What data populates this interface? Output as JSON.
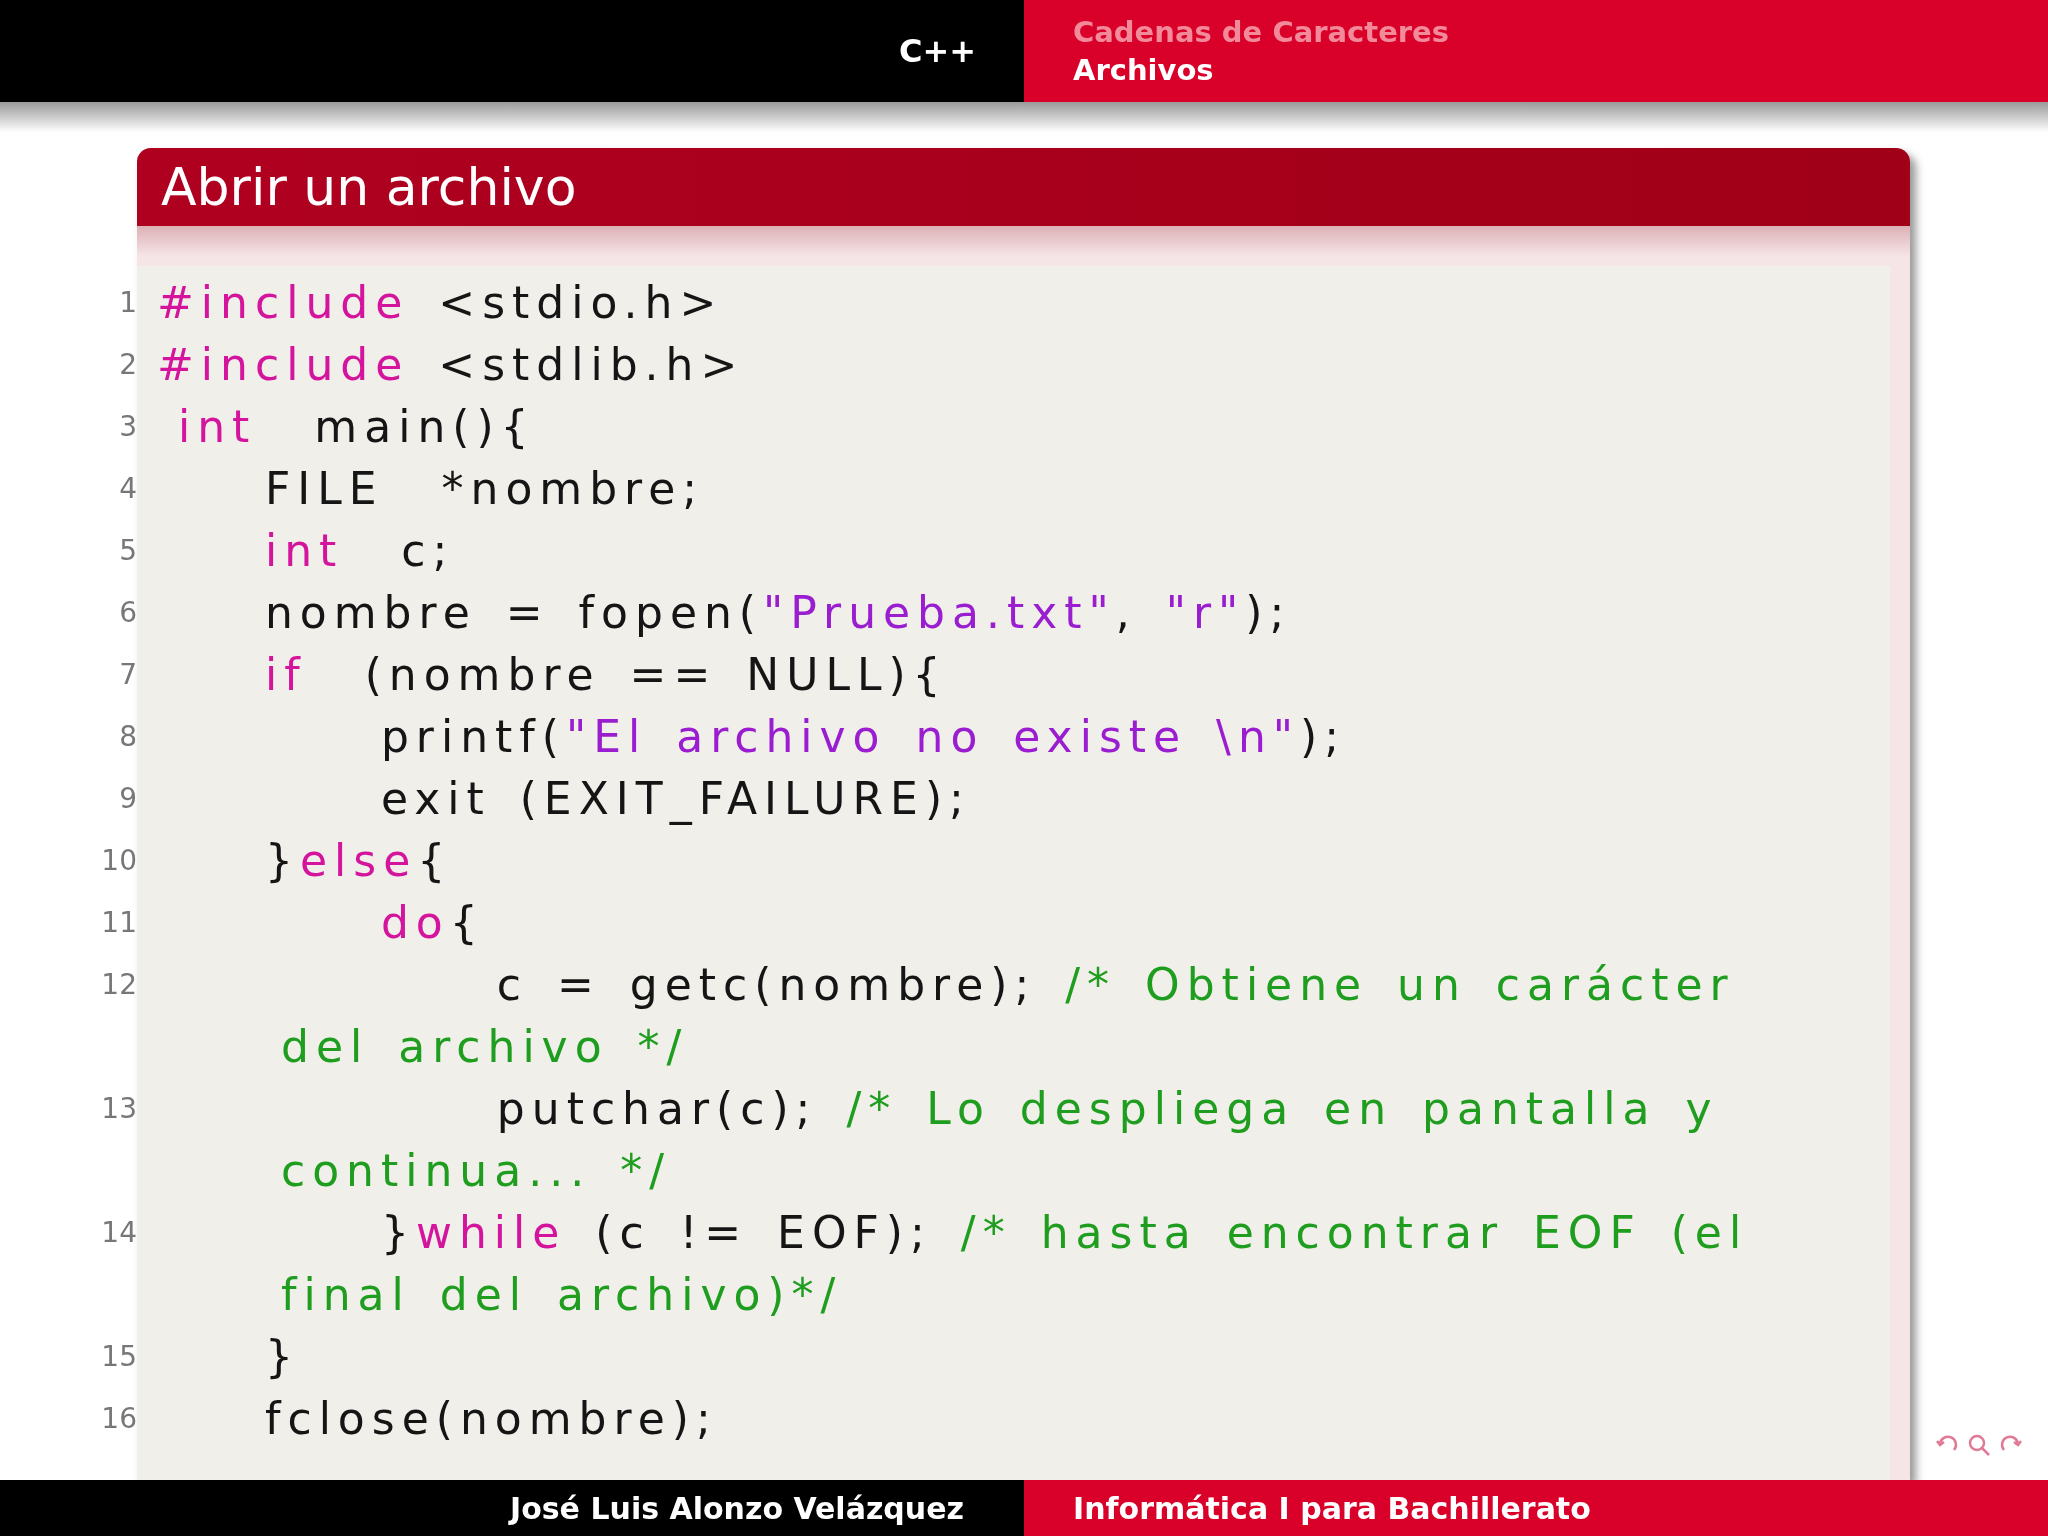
{
  "header": {
    "left": "C++",
    "sections": [
      {
        "label": "Cadenas de Caracteres",
        "selected": false
      },
      {
        "label": "Archivos",
        "selected": true
      }
    ]
  },
  "frame": {
    "title": "Abrir un archivo",
    "lines": [
      {
        "number": "1",
        "tokens": [
          {
            "kind": "keyword",
            "text": "#include"
          },
          {
            "kind": "plain",
            "text": " <stdio.h>"
          }
        ]
      },
      {
        "number": "2",
        "tokens": [
          {
            "kind": "keyword",
            "text": "#include"
          },
          {
            "kind": "plain",
            "text": " <stdlib.h>"
          }
        ]
      },
      {
        "number": "3",
        "tokens": [
          {
            "kind": "keyword",
            "text": " int"
          },
          {
            "kind": "plain",
            "text": "  main(){"
          }
        ]
      },
      {
        "number": "4",
        "tokens": [
          {
            "kind": "plain",
            "text": "    FILE  *nombre;"
          }
        ]
      },
      {
        "number": "5",
        "tokens": [
          {
            "kind": "keyword",
            "text": "    int"
          },
          {
            "kind": "plain",
            "text": "  c;"
          }
        ]
      },
      {
        "number": "6",
        "tokens": [
          {
            "kind": "plain",
            "text": "    nombre = fopen("
          },
          {
            "kind": "string",
            "text": "\"Prueba.txt\""
          },
          {
            "kind": "plain",
            "text": ", "
          },
          {
            "kind": "string",
            "text": "\"r\""
          },
          {
            "kind": "plain",
            "text": ");"
          }
        ]
      },
      {
        "number": "7",
        "tokens": [
          {
            "kind": "keyword",
            "text": "    if"
          },
          {
            "kind": "plain",
            "text": "  (nombre == NULL){"
          }
        ]
      },
      {
        "number": "8",
        "tokens": [
          {
            "kind": "plain",
            "text": "        printf("
          },
          {
            "kind": "string",
            "text": "\"El archivo no existe \\n\""
          },
          {
            "kind": "plain",
            "text": ");"
          }
        ]
      },
      {
        "number": "9",
        "tokens": [
          {
            "kind": "plain",
            "text": "        exit (EXIT_FAILURE);"
          }
        ]
      },
      {
        "number": "10",
        "tokens": [
          {
            "kind": "plain",
            "text": "    }"
          },
          {
            "kind": "keyword",
            "text": "else"
          },
          {
            "kind": "plain",
            "text": "{"
          }
        ]
      },
      {
        "number": "11",
        "tokens": [
          {
            "kind": "keyword",
            "text": "        do"
          },
          {
            "kind": "plain",
            "text": "{"
          }
        ]
      },
      {
        "number": "12",
        "tokens": [
          {
            "kind": "plain",
            "text": "            c = getc(nombre); "
          },
          {
            "kind": "comment",
            "text": "/* Obtiene un carácter"
          }
        ],
        "wrap": [
          {
            "kind": "comment",
            "text": "del archivo */"
          }
        ]
      },
      {
        "number": "13",
        "tokens": [
          {
            "kind": "plain",
            "text": "            putchar(c); "
          },
          {
            "kind": "comment",
            "text": "/* Lo despliega en pantalla y"
          }
        ],
        "wrap": [
          {
            "kind": "comment",
            "text": "continua... */"
          }
        ]
      },
      {
        "number": "14",
        "tokens": [
          {
            "kind": "plain",
            "text": "        }"
          },
          {
            "kind": "keyword",
            "text": "while"
          },
          {
            "kind": "plain",
            "text": " (c != EOF); "
          },
          {
            "kind": "comment",
            "text": "/* hasta encontrar EOF (el"
          }
        ],
        "wrap": [
          {
            "kind": "comment",
            "text": "final del archivo)*/"
          }
        ]
      },
      {
        "number": "15",
        "tokens": [
          {
            "kind": "plain",
            "text": "    }"
          }
        ]
      },
      {
        "number": "16",
        "tokens": [
          {
            "kind": "plain",
            "text": "    fclose(nombre);"
          }
        ]
      }
    ]
  },
  "footer": {
    "author": "José Luis Alonzo Velázquez",
    "course": "Informática I para Bachillerato"
  }
}
